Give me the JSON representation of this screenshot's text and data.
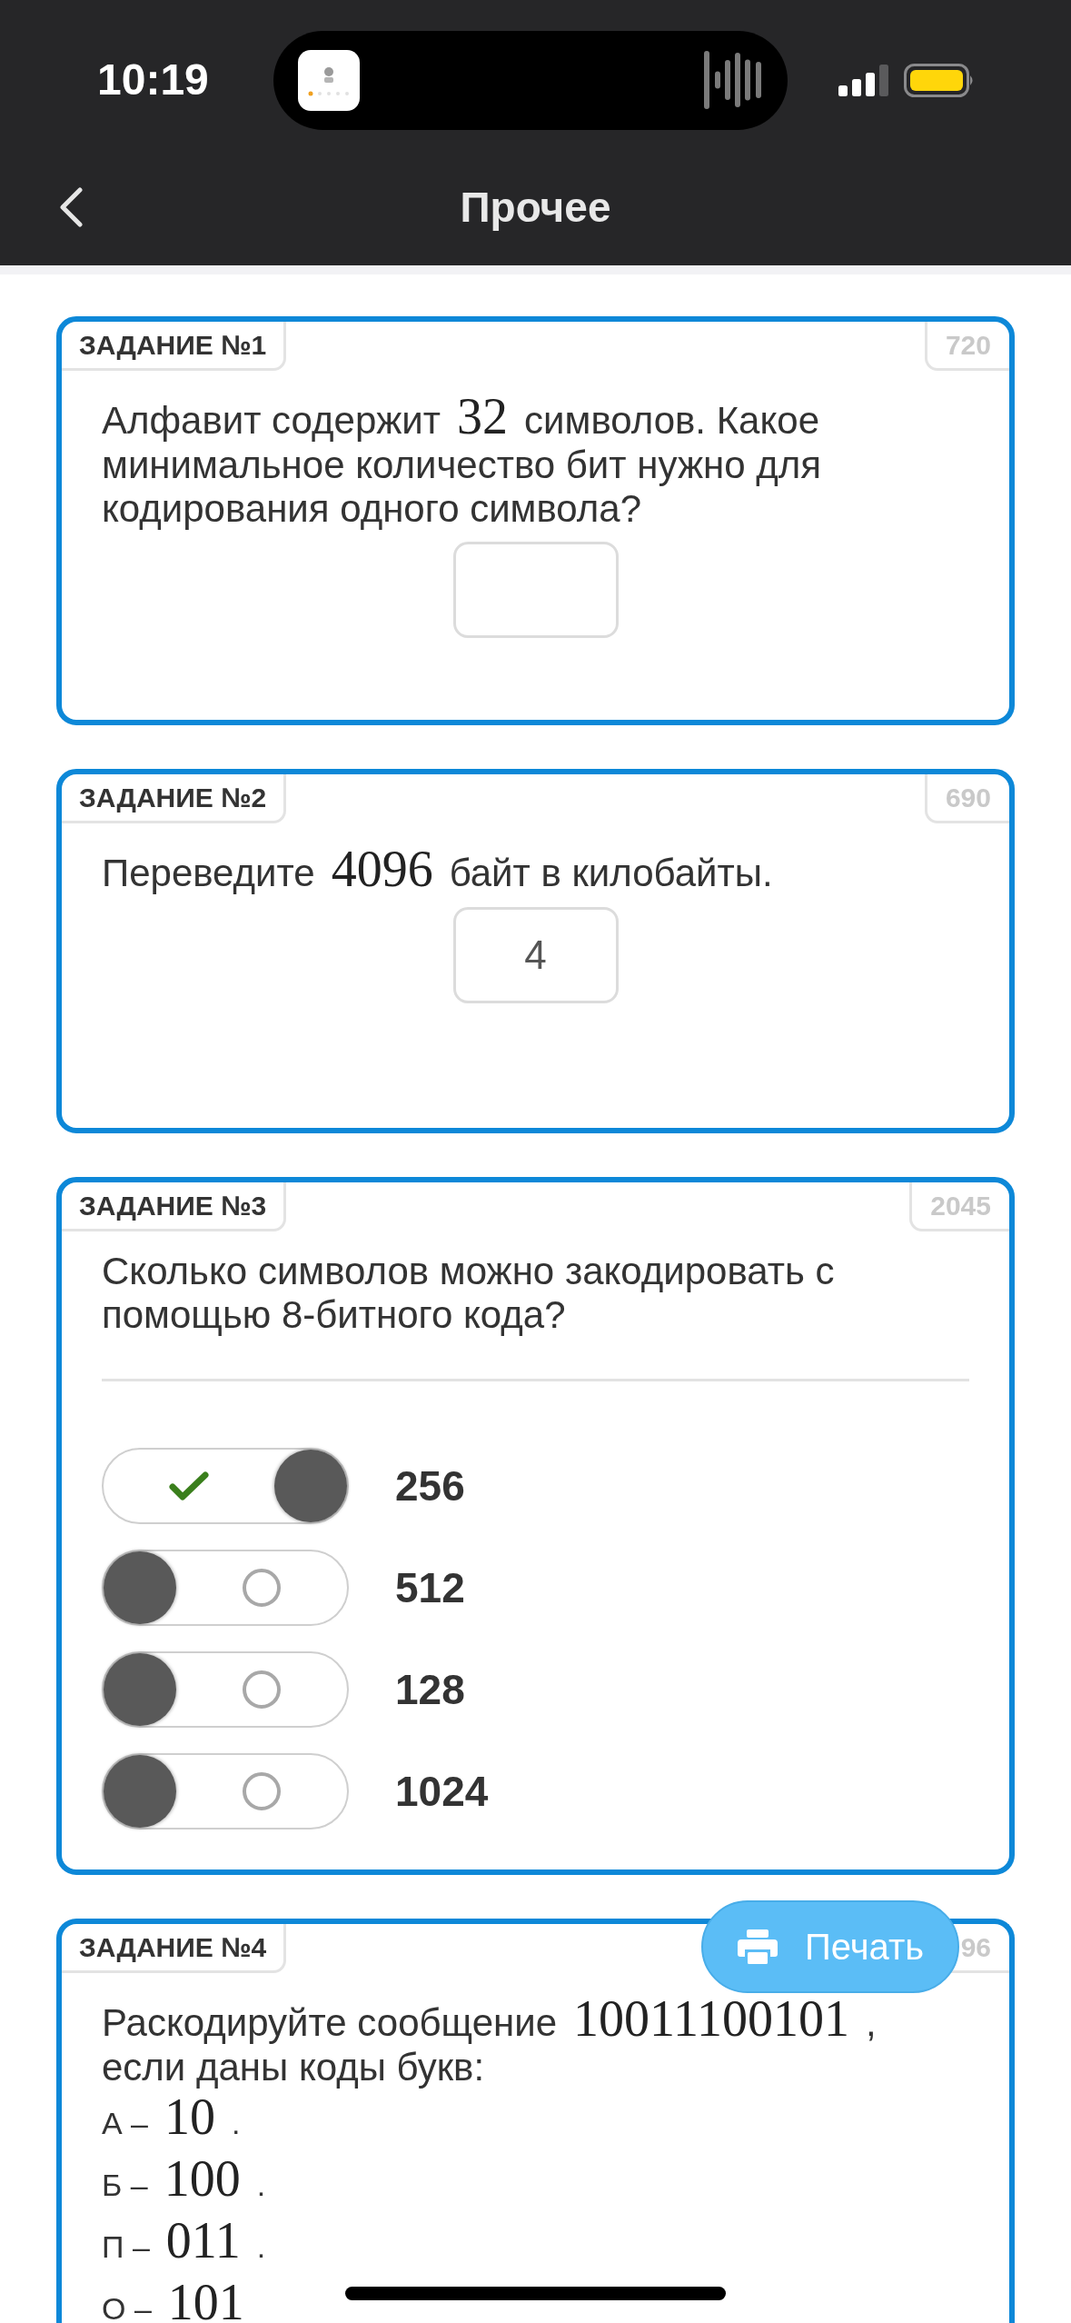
{
  "status_bar": {
    "time": "10:19"
  },
  "nav": {
    "title": "Прочее"
  },
  "tasks": [
    {
      "label": "ЗАДАНИЕ №1",
      "score": "720",
      "question": [
        {
          "kind": "text",
          "text": "Алфавит содержит"
        },
        {
          "kind": "math",
          "text": "32"
        },
        {
          "kind": "text",
          "text": "символов. Какое минимальное количество бит нужно для кодирования одного символа?"
        }
      ],
      "answer": {
        "kind": "input"
      }
    },
    {
      "label": "ЗАДАНИЕ №2",
      "score": "690",
      "question": [
        {
          "kind": "text",
          "text": "Переведите"
        },
        {
          "kind": "math",
          "text": "4096"
        },
        {
          "kind": "text",
          "text": "байт в килобайты."
        }
      ],
      "answer": {
        "kind": "input",
        "value": "4"
      }
    },
    {
      "label": "ЗАДАНИЕ №3",
      "score": "2045",
      "question": [
        {
          "kind": "text",
          "text": "Сколько символов можно закодировать с помощью 8-битного кода?"
        }
      ],
      "answer": {
        "kind": "options",
        "options": [
          {
            "label": "256",
            "selected": true
          },
          {
            "label": "512",
            "selected": false
          },
          {
            "label": "128",
            "selected": false
          },
          {
            "label": "1024",
            "selected": false
          }
        ]
      }
    },
    {
      "label": "ЗАДАНИЕ №4",
      "score": "96",
      "question": [
        {
          "kind": "text",
          "text": "Раскодируйте сообщение"
        },
        {
          "kind": "math",
          "text": "10011100101"
        },
        {
          "kind": "text",
          "text": ", если даны коды букв:"
        }
      ],
      "code_lines": [
        [
          {
            "kind": "text",
            "text": "А –"
          },
          {
            "kind": "math",
            "text": "10"
          },
          {
            "kind": "text",
            "text": "."
          }
        ],
        [
          {
            "kind": "text",
            "text": "Б –"
          },
          {
            "kind": "math",
            "text": "100"
          },
          {
            "kind": "text",
            "text": "."
          }
        ],
        [
          {
            "kind": "text",
            "text": "П –"
          },
          {
            "kind": "math",
            "text": "011"
          },
          {
            "kind": "text",
            "text": "."
          }
        ],
        [
          {
            "kind": "text",
            "text": "О –"
          },
          {
            "kind": "math",
            "text": "101"
          }
        ]
      ]
    }
  ],
  "print_button": {
    "label": "Печать"
  }
}
